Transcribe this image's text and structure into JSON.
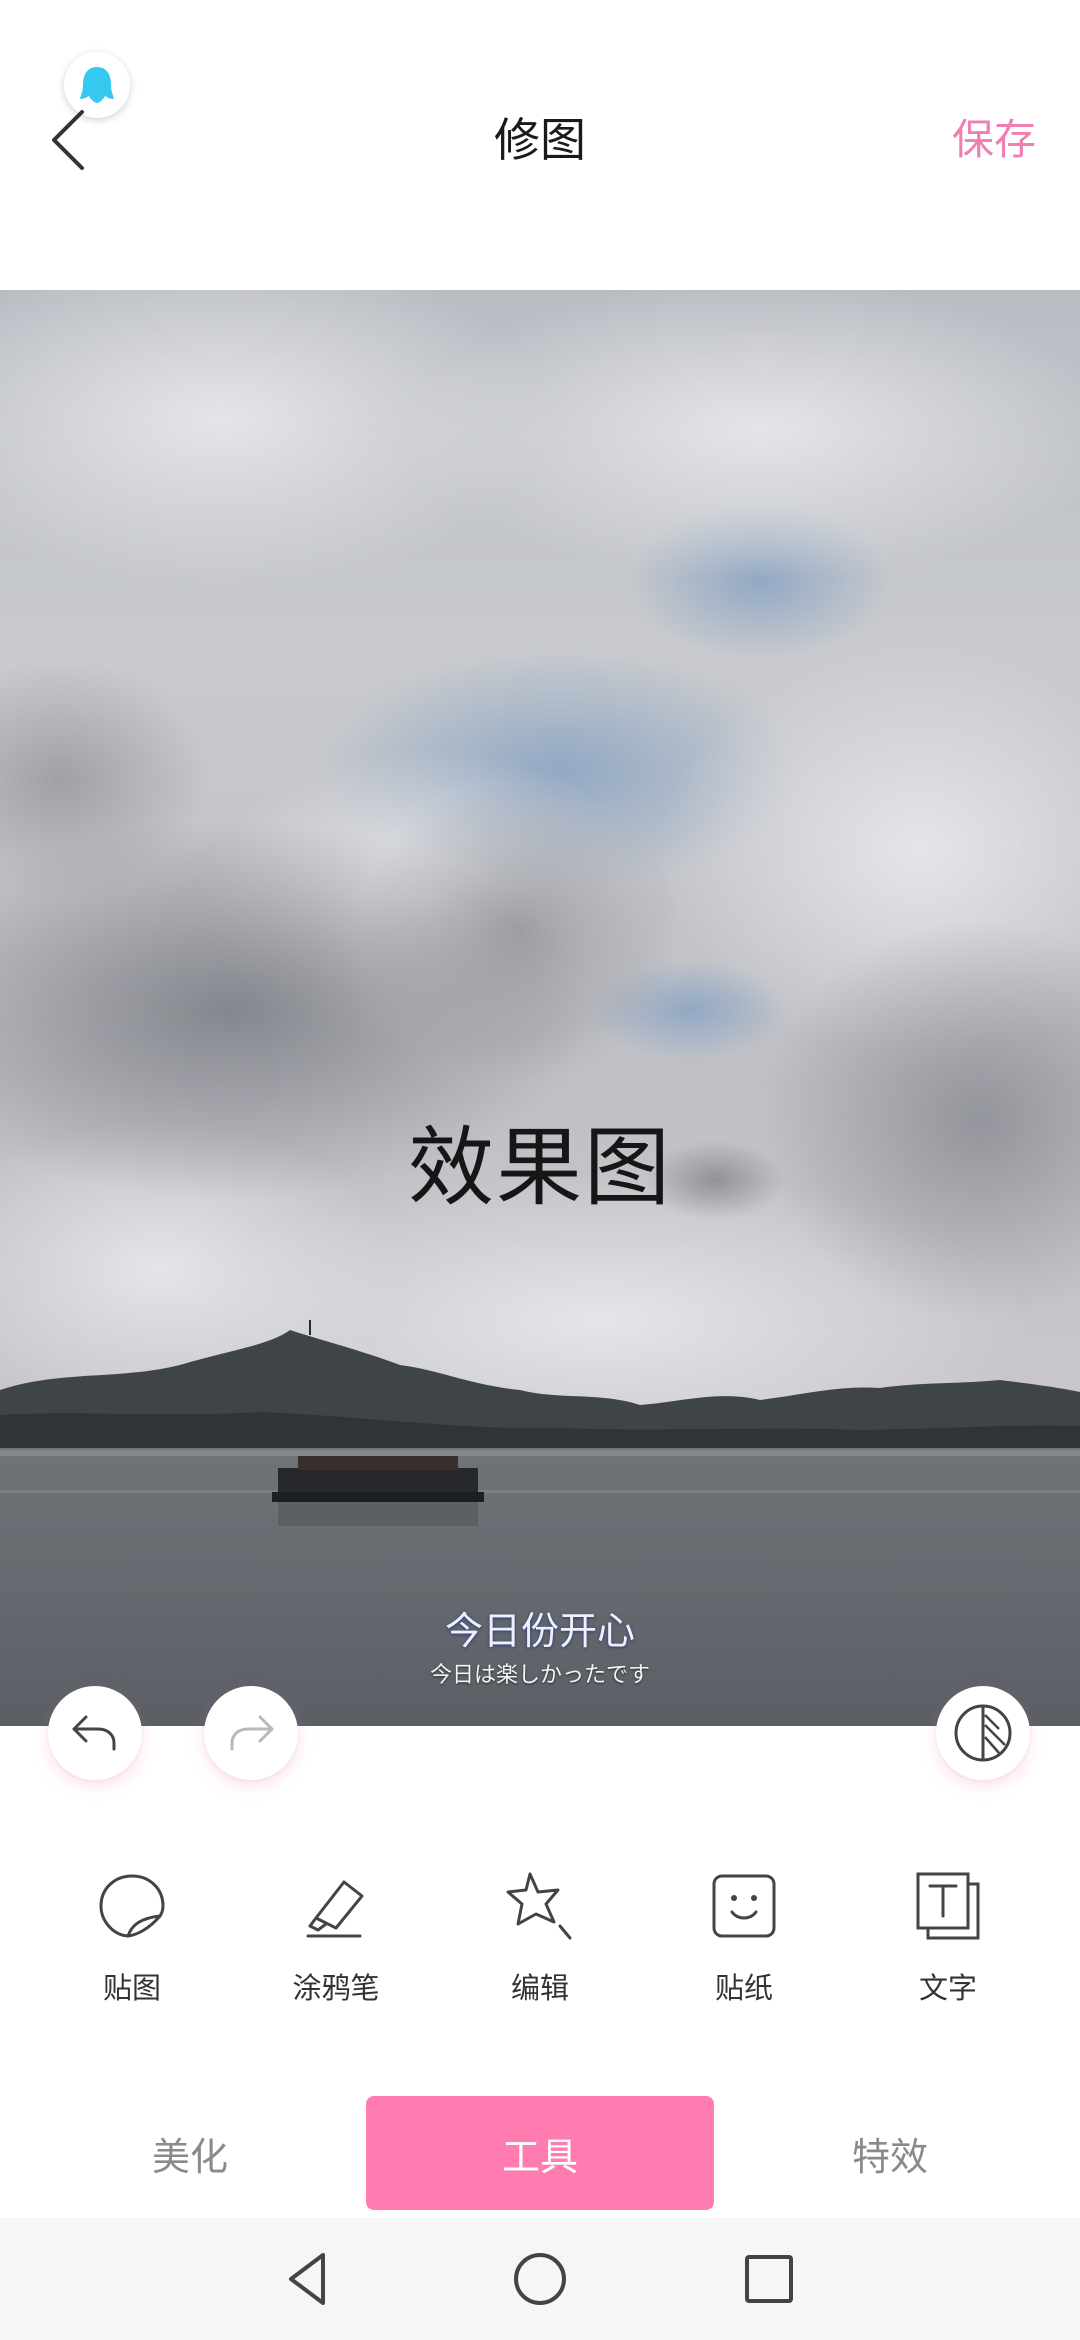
{
  "header": {
    "title": "修图",
    "save_label": "保存"
  },
  "photo": {
    "effect_label": "效果图",
    "caption_main": "今日份开心",
    "caption_sub": "今日は楽しかったです"
  },
  "history": {
    "undo_icon": "undo-arrow-icon",
    "redo_icon": "redo-arrow-icon",
    "compare_icon": "compare-half-circle-icon"
  },
  "tools": [
    {
      "label": "贴图",
      "icon": "sticker-map-icon"
    },
    {
      "label": "涂鸦笔",
      "icon": "eraser-pen-icon"
    },
    {
      "label": "编辑",
      "icon": "star-edit-icon"
    },
    {
      "label": "贴纸",
      "icon": "smiley-sticker-icon"
    },
    {
      "label": "文字",
      "icon": "text-icon"
    }
  ],
  "tabs": [
    {
      "label": "美化",
      "active": false
    },
    {
      "label": "工具",
      "active": true
    },
    {
      "label": "特效",
      "active": false
    }
  ],
  "colors": {
    "accent": "#ff7bb0",
    "save_text": "#f27db3",
    "inactive_tab_text": "#8a8a8a",
    "qq_badge": "#36c9f0"
  }
}
